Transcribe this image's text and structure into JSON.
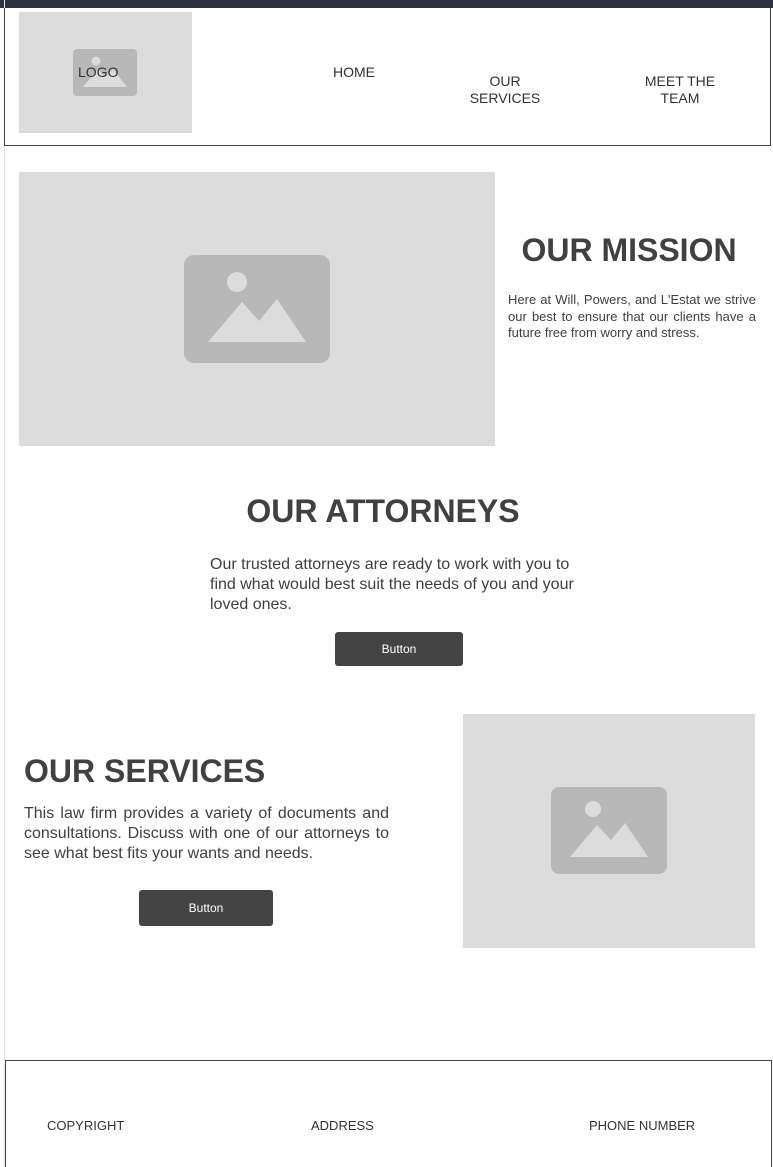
{
  "header": {
    "logo_label": "LOGO",
    "nav": [
      {
        "label": "HOME"
      },
      {
        "label": "OUR\nSERVICES"
      },
      {
        "label": "MEET THE\nTEAM"
      }
    ]
  },
  "mission": {
    "title": "OUR MISSION",
    "text": "Here at Will, Powers, and L'Estat we strive our best to ensure that our clients have a future free from worry and stress."
  },
  "attorneys": {
    "title": "OUR ATTORNEYS",
    "text": "Our trusted attorneys are ready to work with you to find what would best suit the needs of you and your loved ones.",
    "button_label": "Button"
  },
  "services": {
    "title": "OUR SERVICES",
    "text": "This law firm provides a variety of documents and consultations. Discuss with one of our attorneys to see what best fits your wants and needs.",
    "button_label": "Button"
  },
  "footer": {
    "copyright": "COPYRIGHT",
    "address": "ADDRESS",
    "phone": "PHONE NUMBER"
  },
  "colors": {
    "topbar": "#2b3340",
    "placeholder": "#dcdcdc",
    "placeholder_icon": "#b8b8b8",
    "button": "#444444"
  }
}
